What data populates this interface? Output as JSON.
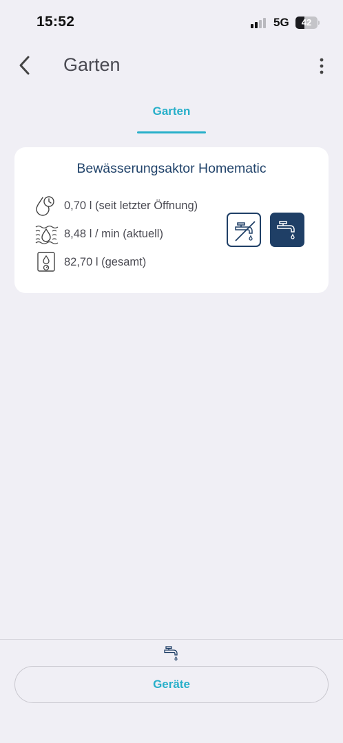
{
  "status_bar": {
    "time": "15:52",
    "network": "5G",
    "battery_level": "42",
    "battery_fraction": 0.42,
    "signal_bars_active": 2,
    "signal_bars_total": 4
  },
  "nav": {
    "title": "Garten",
    "back_icon": "chevron-left-icon",
    "more_icon": "more-vertical-icon"
  },
  "tabs": [
    {
      "label": "Garten",
      "active": true
    }
  ],
  "card": {
    "title": "Bewässerungsaktor Homematic",
    "stats": [
      {
        "icon": "drop-clock-icon",
        "text": "0,70 l (seit letzter Öffnung)"
      },
      {
        "icon": "water-flow-icon",
        "text": "8,48 l / min (aktuell)"
      },
      {
        "icon": "water-meter-icon",
        "text": "82,70 l (gesamt)"
      }
    ],
    "controls": [
      {
        "name": "valve-close",
        "icon": "tap-off-icon",
        "selected": false
      },
      {
        "name": "valve-open",
        "icon": "tap-on-icon",
        "selected": true
      }
    ]
  },
  "bottom": {
    "icon": "tap-icon",
    "button_label": "Geräte"
  },
  "colors": {
    "accent": "#27afc9",
    "navy": "#1f3f66",
    "background": "#f0eff5",
    "card": "#ffffff"
  }
}
